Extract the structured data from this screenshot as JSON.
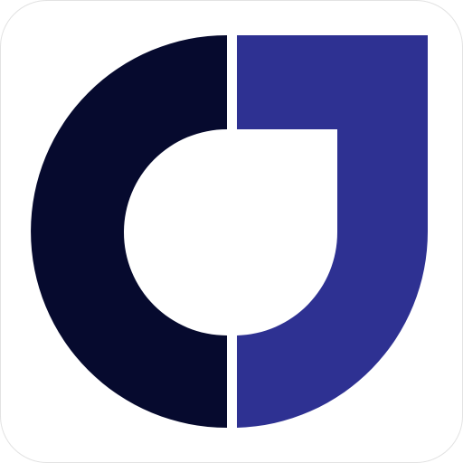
{
  "app_icon": {
    "icon": "brand-logo-icon",
    "colors": {
      "background": "#ffffff",
      "tile_border": "#e2e2e2",
      "left_half": "#060a2e",
      "right_half": "#2e3192"
    }
  }
}
